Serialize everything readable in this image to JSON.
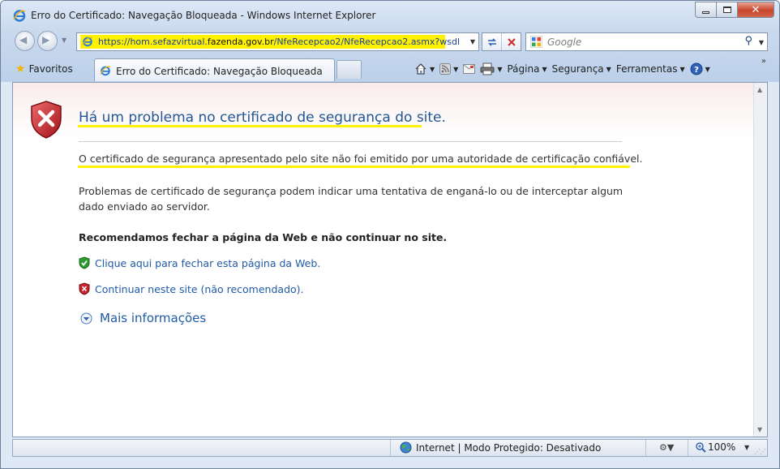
{
  "window": {
    "title": "Erro do Certificado: Navegação Bloqueada - Windows Internet Explorer"
  },
  "navigation": {
    "address_protocol": "https://",
    "address_host_prefix": "hom.sefazvirtual.",
    "address_domain": "fazenda.gov.br",
    "address_path": "/NfeRecepcao2/NfeRecepcao2.asmx?wsdl",
    "search_placeholder": "Google"
  },
  "tabs": {
    "favorites_label": "Favoritos",
    "active_tab_title": "Erro do Certificado: Navegação Bloqueada"
  },
  "command_bar": {
    "page_label": "Página",
    "security_label": "Segurança",
    "tools_label": "Ferramentas"
  },
  "content": {
    "heading": "Há um problema no certificado de segurança do site.",
    "paragraph1": "O certificado de segurança apresentado pelo site não foi emitido por uma autoridade de certificação confiável.",
    "paragraph2": "Problemas de certificado de segurança podem indicar uma tentativa de enganá-lo ou de interceptar algum dado enviado ao servidor.",
    "recommendation": "Recomendamos fechar a página da Web e não continuar no site.",
    "close_link": "Clique aqui para fechar esta página da Web.",
    "continue_link": "Continuar neste site (não recomendado).",
    "more_info": "Mais informações"
  },
  "status_bar": {
    "zone": "Internet | Modo Protegido: Desativado",
    "zoom": "100%"
  },
  "colors": {
    "highlight": "#fff200",
    "link": "#1f5aa6",
    "heading": "#225596",
    "danger_shield": "#c8242a",
    "safe_shield": "#2f9a33"
  },
  "icons": [
    "ie-logo-icon",
    "back-icon",
    "forward-icon",
    "refresh-icon",
    "stop-icon",
    "google-icon",
    "search-icon",
    "star-icon",
    "home-icon",
    "feeds-icon",
    "mail-icon",
    "print-icon",
    "help-icon",
    "shield-error-icon",
    "shield-ok-icon",
    "chevron-down-icon",
    "globe-icon",
    "zoom-icon"
  ]
}
